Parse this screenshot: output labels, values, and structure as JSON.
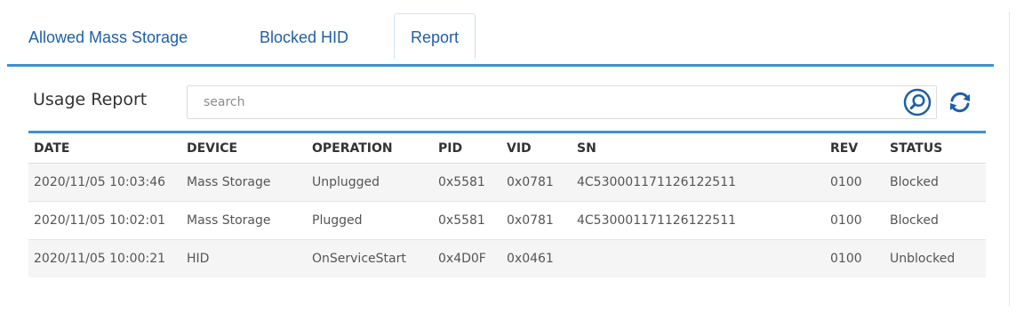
{
  "tabs": [
    {
      "label": "Allowed Mass Storage"
    },
    {
      "label": "Blocked HID"
    },
    {
      "label": "Report",
      "selected": true
    }
  ],
  "header": {
    "title": "Usage Report",
    "search_placeholder": "search",
    "search_icon": "search-icon",
    "refresh_icon": "refresh-icon"
  },
  "colors": {
    "accent": "#3e8fd6",
    "tab_text": "#1f5fa6",
    "row_stripe": "#f5f5f5"
  },
  "table": {
    "columns": [
      "DATE",
      "DEVICE",
      "OPERATION",
      "PID",
      "VID",
      "SN",
      "REV",
      "STATUS"
    ],
    "rows": [
      [
        "2020/11/05 10:03:46",
        "Mass Storage",
        "Unplugged",
        "0x5581",
        "0x0781",
        "4C530001171126122511",
        "0100",
        "Blocked"
      ],
      [
        "2020/11/05 10:02:01",
        "Mass Storage",
        "Plugged",
        "0x5581",
        "0x0781",
        "4C530001171126122511",
        "0100",
        "Blocked"
      ],
      [
        "2020/11/05 10:00:21",
        "HID",
        "OnServiceStart",
        "0x4D0F",
        "0x0461",
        "",
        "0100",
        "Unblocked"
      ]
    ]
  }
}
